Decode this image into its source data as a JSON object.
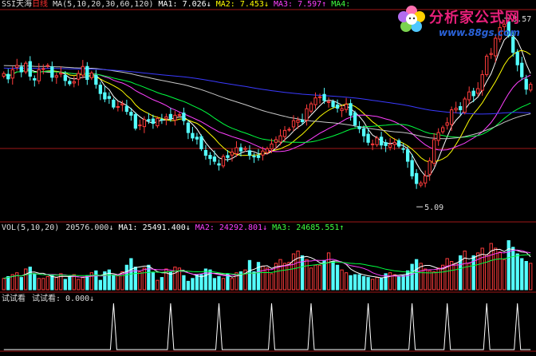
{
  "colors": {
    "background": "#000000",
    "axis": "#a01818",
    "up": "#ff3c3c",
    "down": "#54ffff",
    "ma1": "#ffffff",
    "ma2": "#ff40ff",
    "ma3": "#00ff40",
    "ma4": "#c8c8c8",
    "ma5": "#3a3aff",
    "label_yellow": "#ffff00",
    "label_magenta": "#ff40ff",
    "label_green": "#40ff40",
    "label_red": "#ff3030"
  },
  "price_panel": {
    "code": "SSI天海",
    "period": "日线",
    "ma_param": "MA(5,10,20,30,60,120)",
    "ma1": "MA1: 7.026↓",
    "ma2": "MA2: 7.453↓",
    "ma3": "MA3: 7.597↑",
    "ma4": "MA4:",
    "high_marker": "8.57",
    "low_marker": "5.09"
  },
  "volume_panel": {
    "title": "VOL(5,10,20)",
    "value": "20576.000↓",
    "ma1": "MA1: 25491.400↓",
    "ma2": "MA2: 24292.801↓",
    "ma3": "MA3: 24685.551↑"
  },
  "test_panel": {
    "title": "试试看",
    "label": "试试看: 0.000↓"
  },
  "logo": {
    "text": "分析家公式网",
    "url": "www.88gs.com"
  },
  "chart_data": {
    "type": "candlestick",
    "price_ylim": [
      4.9,
      8.7
    ],
    "price_high": 8.57,
    "price_low": 5.09,
    "close": [
      7.55,
      7.45,
      7.62,
      7.7,
      7.58,
      7.74,
      7.5,
      7.43,
      7.62,
      7.64,
      7.7,
      7.48,
      7.51,
      7.56,
      7.42,
      7.36,
      7.4,
      7.55,
      7.68,
      7.44,
      7.56,
      7.35,
      7.18,
      7.08,
      7.09,
      6.93,
      6.94,
      6.99,
      6.85,
      6.78,
      6.54,
      6.6,
      6.7,
      6.68,
      6.63,
      6.72,
      6.7,
      6.75,
      6.72,
      6.78,
      6.79,
      6.68,
      6.46,
      6.36,
      6.34,
      6.16,
      6.04,
      5.98,
      5.93,
      5.86,
      6.02,
      6.0,
      6.1,
      6.18,
      6.12,
      6.17,
      6.04,
      6.02,
      6.0,
      6.12,
      6.16,
      6.25,
      6.33,
      6.4,
      6.5,
      6.52,
      6.68,
      6.69,
      6.66,
      6.9,
      6.99,
      7.1,
      7.12,
      7.05,
      7.03,
      6.94,
      6.91,
      6.9,
      6.98,
      6.78,
      6.6,
      6.53,
      6.4,
      6.28,
      6.25,
      6.36,
      6.23,
      6.22,
      6.24,
      6.28,
      6.21,
      6.16,
      5.93,
      5.66,
      5.52,
      5.53,
      5.66,
      5.94,
      6.33,
      6.46,
      6.55,
      6.64,
      6.88,
      6.91,
      6.88,
      7.08,
      7.21,
      7.14,
      7.27,
      7.53,
      7.87,
      7.92,
      8.2,
      8.4,
      8.46,
      8.25,
      7.94,
      7.71,
      7.49,
      7.26,
      7.35
    ],
    "volume": [
      12,
      14,
      16,
      18,
      13,
      22,
      24,
      17,
      12,
      12,
      14,
      15,
      13,
      17,
      11,
      14,
      16,
      11,
      13,
      15,
      18,
      20,
      10,
      19,
      21,
      15,
      15,
      19,
      26,
      33,
      24,
      19,
      23,
      26,
      18,
      10,
      13,
      22,
      19,
      24,
      23,
      15,
      9,
      12,
      16,
      16,
      22,
      21,
      12,
      14,
      12,
      17,
      12,
      18,
      19,
      21,
      31,
      19,
      29,
      25,
      23,
      17,
      28,
      32,
      28,
      29,
      38,
      41,
      36,
      32,
      23,
      26,
      26,
      31,
      39,
      30,
      26,
      21,
      18,
      15,
      16,
      16,
      14,
      13,
      11,
      13,
      12,
      17,
      18,
      16,
      14,
      15,
      20,
      27,
      32,
      28,
      22,
      20,
      19,
      23,
      26,
      33,
      30,
      28,
      36,
      41,
      28,
      36,
      39,
      44,
      37,
      49,
      44,
      40,
      32,
      52,
      45,
      38,
      33,
      30,
      28
    ],
    "volume_ylim": [
      0,
      60
    ],
    "test_values": [
      0,
      0,
      0,
      0,
      0,
      0,
      0,
      0,
      0,
      0,
      0,
      0,
      0,
      0,
      0,
      0,
      0,
      0,
      0,
      0,
      0,
      0,
      0,
      0,
      0,
      1,
      0,
      0,
      0,
      0,
      0,
      0,
      0,
      0,
      0,
      0,
      0,
      0,
      1,
      0,
      0,
      0,
      0,
      0,
      0,
      0,
      0,
      0,
      0,
      1,
      0,
      0,
      0,
      0,
      0,
      0,
      0,
      0,
      0,
      0,
      0,
      1,
      0,
      0,
      0,
      0,
      0,
      0,
      0,
      0,
      1,
      0,
      0,
      0,
      0,
      0,
      0,
      0,
      0,
      0,
      0,
      0,
      0,
      1,
      0,
      0,
      0,
      0,
      0,
      0,
      0,
      0,
      0,
      1,
      0,
      0,
      0,
      0,
      0,
      0,
      0,
      1,
      0,
      0,
      0,
      0,
      0,
      0,
      0,
      0,
      1,
      0,
      0,
      0,
      0,
      0,
      0,
      1,
      0,
      0,
      0
    ],
    "ma_periods": [
      5,
      10,
      20,
      30,
      60,
      120
    ],
    "test_ylim": [
      0,
      1
    ]
  }
}
